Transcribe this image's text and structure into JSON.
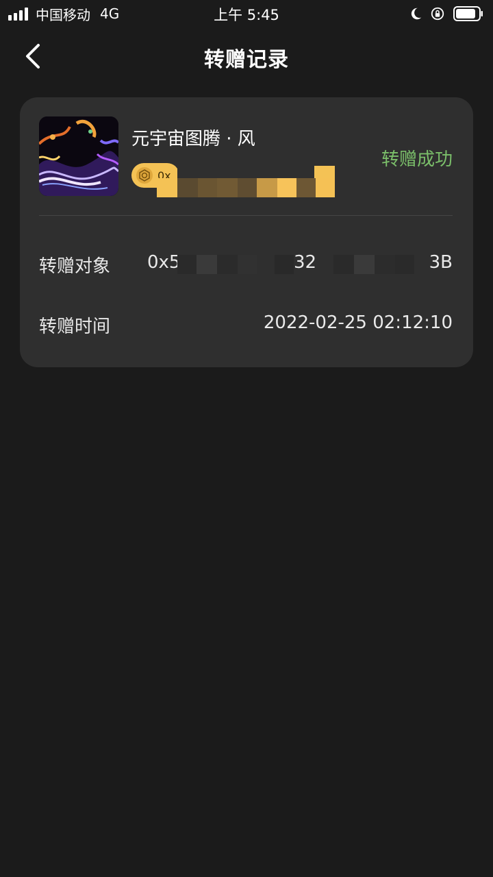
{
  "status_bar": {
    "carrier": "中国移动",
    "network": "4G",
    "time": "上午 5:45"
  },
  "nav": {
    "title": "转赠记录",
    "back_icon": "chevron-left-icon"
  },
  "record": {
    "item_name": "元宇宙图腾 · 风",
    "owner_address_visible": "0x",
    "status": "转赠成功",
    "status_color": "#7bbf6a",
    "chip_color": "#f4c255",
    "recipient_label": "转赠对象",
    "recipient_address_parts": [
      "0x5",
      "32",
      "3B"
    ],
    "time_label": "转赠时间",
    "time_value": "2022-02-25 02:12:10"
  }
}
